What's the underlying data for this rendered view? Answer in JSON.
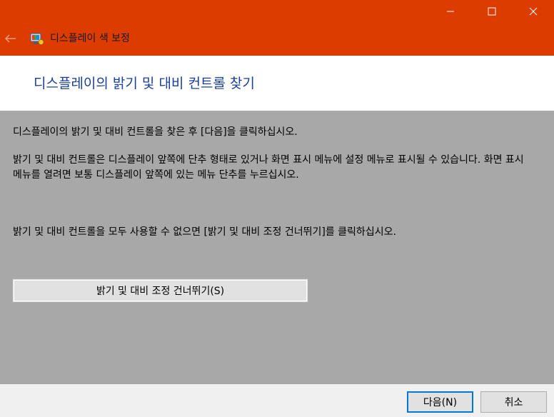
{
  "window": {
    "title": "디스플레이 색 보정",
    "accent_color": "#dc3c00"
  },
  "titlebar_icons": {
    "back": "back-arrow-icon",
    "app": "display-color-calibration-icon",
    "minimize": "minimize-icon",
    "maximize": "maximize-icon",
    "close": "close-icon"
  },
  "header": {
    "heading": "디스플레이의 밝기 및 대비 컨트롤 찾기"
  },
  "content": {
    "paragraph1": "디스플레이의 밝기 및 대비 컨트롤을 찾은 후 [다음]을 클릭하십시오.",
    "paragraph2": "밝기 및 대비 컨트롤은 디스플레이 앞쪽에 단추 형태로 있거나 화면 표시 메뉴에 설정 메뉴로 표시될 수 있습니다. 화면 표시 메뉴를 열려면 보통 디스플레이 앞쪽에 있는 메뉴 단추를 누르십시오.",
    "paragraph3": "밝기 및 대비 컨트롤을 모두 사용할 수 없으면 [밝기 및 대비 조정 건너뛰기]를 클릭하십시오.",
    "skip_button": "밝기 및 대비 조정 건너뛰기(S)"
  },
  "footer": {
    "next_button": "다음(N)",
    "cancel_button": "취소"
  }
}
